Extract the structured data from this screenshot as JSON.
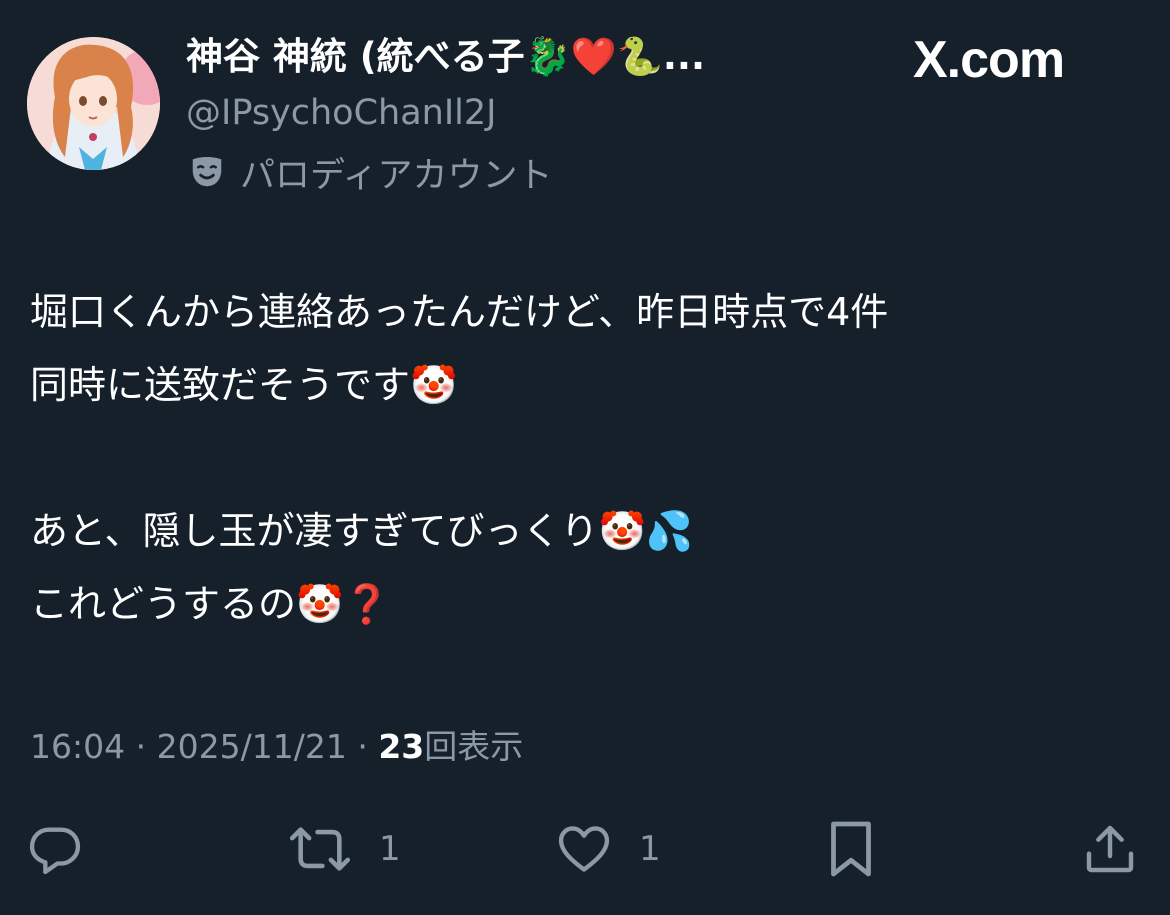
{
  "header": {
    "display_name": "神谷 神統 (統べる子🐉❤️🐍...",
    "handle": "@IPsychoChanIl2J",
    "account_label": "パロディアカウント",
    "brand": "X.com"
  },
  "tweet": {
    "lines": [
      "堀口くんから連絡あったんだけど、昨日時点で4件",
      "同時に送致だそうです🤡",
      "",
      "あと、隠し玉が凄すぎてびっくり🤡💦",
      "これどうするの🤡❓"
    ]
  },
  "meta": {
    "time": "16:04",
    "date": "2025/11/21",
    "views_count": "23",
    "views_label": "回表示",
    "separator": "·"
  },
  "actions": {
    "retweet_count": "1",
    "like_count": "1"
  },
  "icons": {
    "avatar": "anime-avatar",
    "parody": "theater-mask-icon",
    "reply": "reply-icon",
    "retweet": "retweet-icon",
    "like": "heart-icon",
    "bookmark": "bookmark-icon",
    "share": "share-icon"
  },
  "colors": {
    "background": "#15202b",
    "primary_text": "#ffffff",
    "secondary_text": "#8b98a5"
  }
}
